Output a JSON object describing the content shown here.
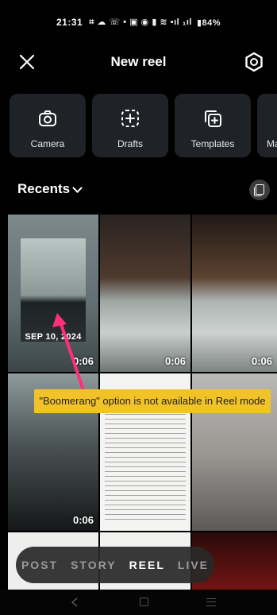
{
  "status_bar": {
    "time": "21:31",
    "glyphs": "⌗ ☁ ☏ •   ▣ ◉ ▮ ≋ ▪ıl ₁ıl",
    "battery": "▮84%"
  },
  "header": {
    "title": "New reel"
  },
  "tiles": [
    {
      "label": "Camera",
      "icon": "camera-icon"
    },
    {
      "label": "Drafts",
      "icon": "drafts-icon"
    },
    {
      "label": "Templates",
      "icon": "templates-icon"
    },
    {
      "label": "Ma",
      "icon": ""
    }
  ],
  "recents": {
    "label": "Recents"
  },
  "grid": {
    "cell1_date": "SEP 10, 2024",
    "durations": [
      "0:06",
      "0:06",
      "0:06",
      "0:06"
    ]
  },
  "tooltip": {
    "text": "\"Boomerang\" option is not available in Reel mode"
  },
  "modes": [
    "POST",
    "STORY",
    "REEL",
    "LIVE"
  ],
  "active_mode": "REEL",
  "colors": {
    "tooltip_bg": "#f2c229",
    "arrow": "#ff2f7a",
    "tile_bg": "#1f2226"
  }
}
